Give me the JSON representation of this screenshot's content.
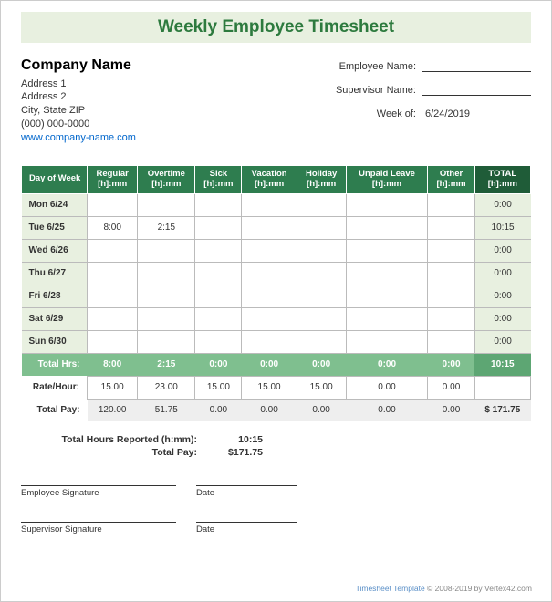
{
  "title": "Weekly Employee Timesheet",
  "company": {
    "name": "Company Name",
    "addr1": "Address 1",
    "addr2": "Address 2",
    "citystate": "City, State  ZIP",
    "phone": "(000) 000-0000",
    "url": "www.company-name.com"
  },
  "meta": {
    "employee_label": "Employee Name:",
    "supervisor_label": "Supervisor Name:",
    "weekof_label": "Week of:",
    "weekof_value": "6/24/2019"
  },
  "columns": {
    "day": "Day of Week",
    "regular": "Regular",
    "overtime": "Overtime",
    "sick": "Sick",
    "vacation": "Vacation",
    "holiday": "Holiday",
    "unpaid": "Unpaid Leave",
    "other": "Other",
    "total": "TOTAL",
    "unit": "[h]:mm"
  },
  "rows": [
    {
      "day": "Mon 6/24",
      "regular": "",
      "overtime": "",
      "sick": "",
      "vacation": "",
      "holiday": "",
      "unpaid": "",
      "other": "",
      "total": "0:00"
    },
    {
      "day": "Tue 6/25",
      "regular": "8:00",
      "overtime": "2:15",
      "sick": "",
      "vacation": "",
      "holiday": "",
      "unpaid": "",
      "other": "",
      "total": "10:15"
    },
    {
      "day": "Wed 6/26",
      "regular": "",
      "overtime": "",
      "sick": "",
      "vacation": "",
      "holiday": "",
      "unpaid": "",
      "other": "",
      "total": "0:00"
    },
    {
      "day": "Thu 6/27",
      "regular": "",
      "overtime": "",
      "sick": "",
      "vacation": "",
      "holiday": "",
      "unpaid": "",
      "other": "",
      "total": "0:00"
    },
    {
      "day": "Fri 6/28",
      "regular": "",
      "overtime": "",
      "sick": "",
      "vacation": "",
      "holiday": "",
      "unpaid": "",
      "other": "",
      "total": "0:00"
    },
    {
      "day": "Sat 6/29",
      "regular": "",
      "overtime": "",
      "sick": "",
      "vacation": "",
      "holiday": "",
      "unpaid": "",
      "other": "",
      "total": "0:00"
    },
    {
      "day": "Sun 6/30",
      "regular": "",
      "overtime": "",
      "sick": "",
      "vacation": "",
      "holiday": "",
      "unpaid": "",
      "other": "",
      "total": "0:00"
    }
  ],
  "totals": {
    "label": "Total Hrs:",
    "regular": "8:00",
    "overtime": "2:15",
    "sick": "0:00",
    "vacation": "0:00",
    "holiday": "0:00",
    "unpaid": "0:00",
    "other": "0:00",
    "total": "10:15"
  },
  "rate": {
    "label": "Rate/Hour:",
    "regular": "15.00",
    "overtime": "23.00",
    "sick": "15.00",
    "vacation": "15.00",
    "holiday": "15.00",
    "unpaid": "0.00",
    "other": "0.00",
    "blank": ""
  },
  "pay": {
    "label": "Total Pay:",
    "regular": "120.00",
    "overtime": "51.75",
    "sick": "0.00",
    "vacation": "0.00",
    "holiday": "0.00",
    "unpaid": "0.00",
    "other": "0.00",
    "total": "$   171.75"
  },
  "summary": {
    "hours_label": "Total Hours Reported (h:mm):",
    "hours_value": "10:15",
    "pay_label": "Total Pay:",
    "pay_value": "$171.75"
  },
  "signatures": {
    "emp": "Employee Signature",
    "sup": "Supervisor Signature",
    "date": "Date"
  },
  "footer": {
    "link": "Timesheet Template",
    "copyright": " © 2008-2019 by Vertex42.com"
  }
}
